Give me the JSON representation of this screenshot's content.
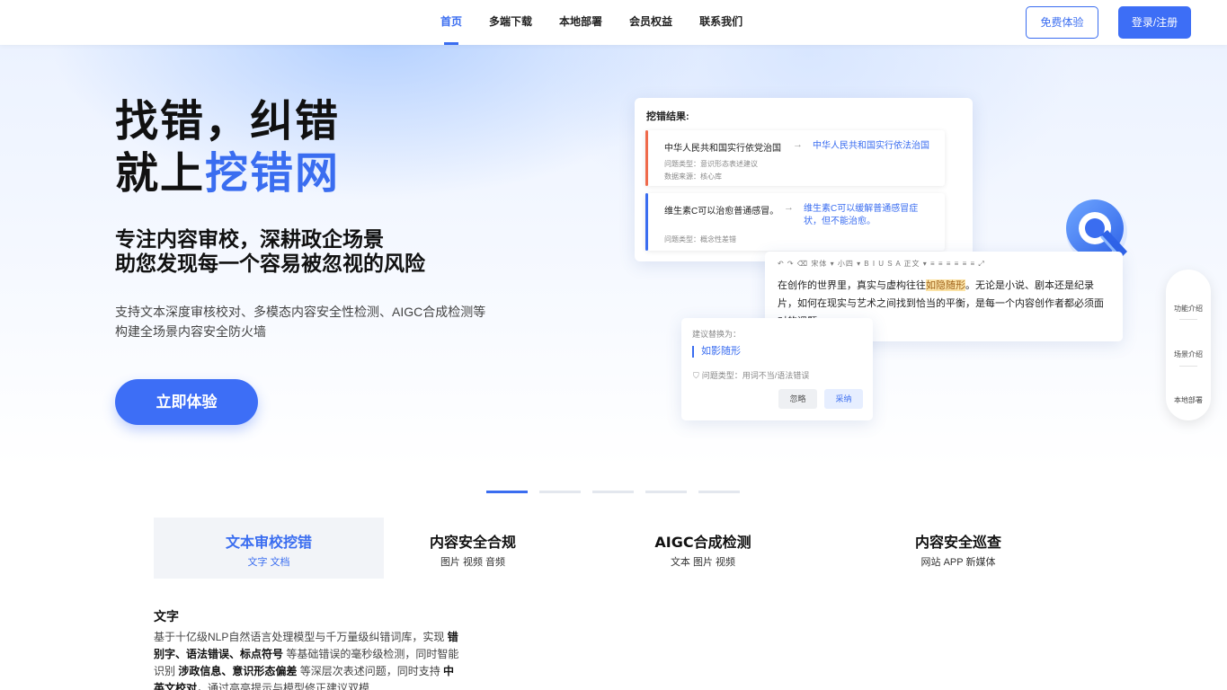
{
  "nav": {
    "items": [
      "首页",
      "多端下载",
      "本地部署",
      "会员权益",
      "联系我们"
    ],
    "active_index": 0,
    "trial_button": "免费体验",
    "login_button": "登录/注册"
  },
  "hero": {
    "headline_line1": "找错，纠错",
    "headline_line2_prefix": "就上",
    "headline_line2_accent": "挖错网",
    "subhead_line1": "专注内容审校，深耕政企场景",
    "subhead_line2": "助您发现每一个容易被忽视的风险",
    "desc_line1": "支持文本深度审核校对、多模态内容安全性检测、AIGC合成检测等",
    "desc_line2": "构建全场景内容安全防火墙",
    "cta": "立即体验"
  },
  "result_card": {
    "title": "挖错结果:",
    "items": [
      {
        "original": "中华人民共和国实行依党治国",
        "arrow": "→",
        "fix_line1": "中华人民共和国实行依法治国",
        "fix_line2": "",
        "meta_line1": "问题类型：意识形态表述建议",
        "meta_line2": "数据来源：核心库",
        "color": "#ef6a4b"
      },
      {
        "original": "维生素C可以治愈普通感冒。",
        "arrow": "→",
        "fix_line1": "维生素C可以缓解普通感冒症",
        "fix_line2": "状，但不能治愈。",
        "meta_line1": "问题类型：概念性差错",
        "meta_line2": "",
        "color": "#3a6df0"
      }
    ]
  },
  "editor": {
    "toolbar": "↶ ↷ ⌫  宋体 ▾  小四 ▾   B  I  U  S  A   正文 ▾  ≡  ≡  ≡  ≡  ≡  ≡  ⤢",
    "text_before": "在创作的世界里，真实与虚构往往",
    "text_highlight": "如隐随形",
    "text_after": "。无论是小说、剧本还是纪录片，如何在现实与艺术之间找到恰当的平衡，是每一个内容创作者都必须面对的课题..."
  },
  "suggestion": {
    "label": "建议替换为：",
    "word": "如影随形",
    "type": "问题类型：用词不当/语法错误",
    "ignore": "忽略",
    "accept": "采纳"
  },
  "side_nav": [
    "功能介绍",
    "场景介绍",
    "本地部署"
  ],
  "carousel": {
    "count": 5,
    "active_index": 0
  },
  "feature_tabs": [
    {
      "title": "文本审校挖错",
      "sub": "文字 文档"
    },
    {
      "title": "内容安全合规",
      "sub": "图片 视频 音频"
    },
    {
      "title": "AIGC合成检测",
      "sub": "文本 图片 视频"
    },
    {
      "title": "内容安全巡查",
      "sub": "网站 APP 新媒体"
    }
  ],
  "feature_active_index": 0,
  "detail": {
    "title": "文字",
    "p1": "基于十亿级NLP自然语言处理模型与千万量级纠错词库，实现 ",
    "b1": "错别字、语法错误、标点符号",
    "p2": " 等基础错误的毫秒级检测，同时智能识别 ",
    "b2": "涉政信息、意识形态偏差",
    "p3": " 等深层次表述问题，同时支持 ",
    "b3": "中英文校对",
    "p4": "，通过高亮提示与模型修正建议双模"
  },
  "colors": {
    "accent": "#3a6df0",
    "brand_button": "#3d6ef6"
  }
}
